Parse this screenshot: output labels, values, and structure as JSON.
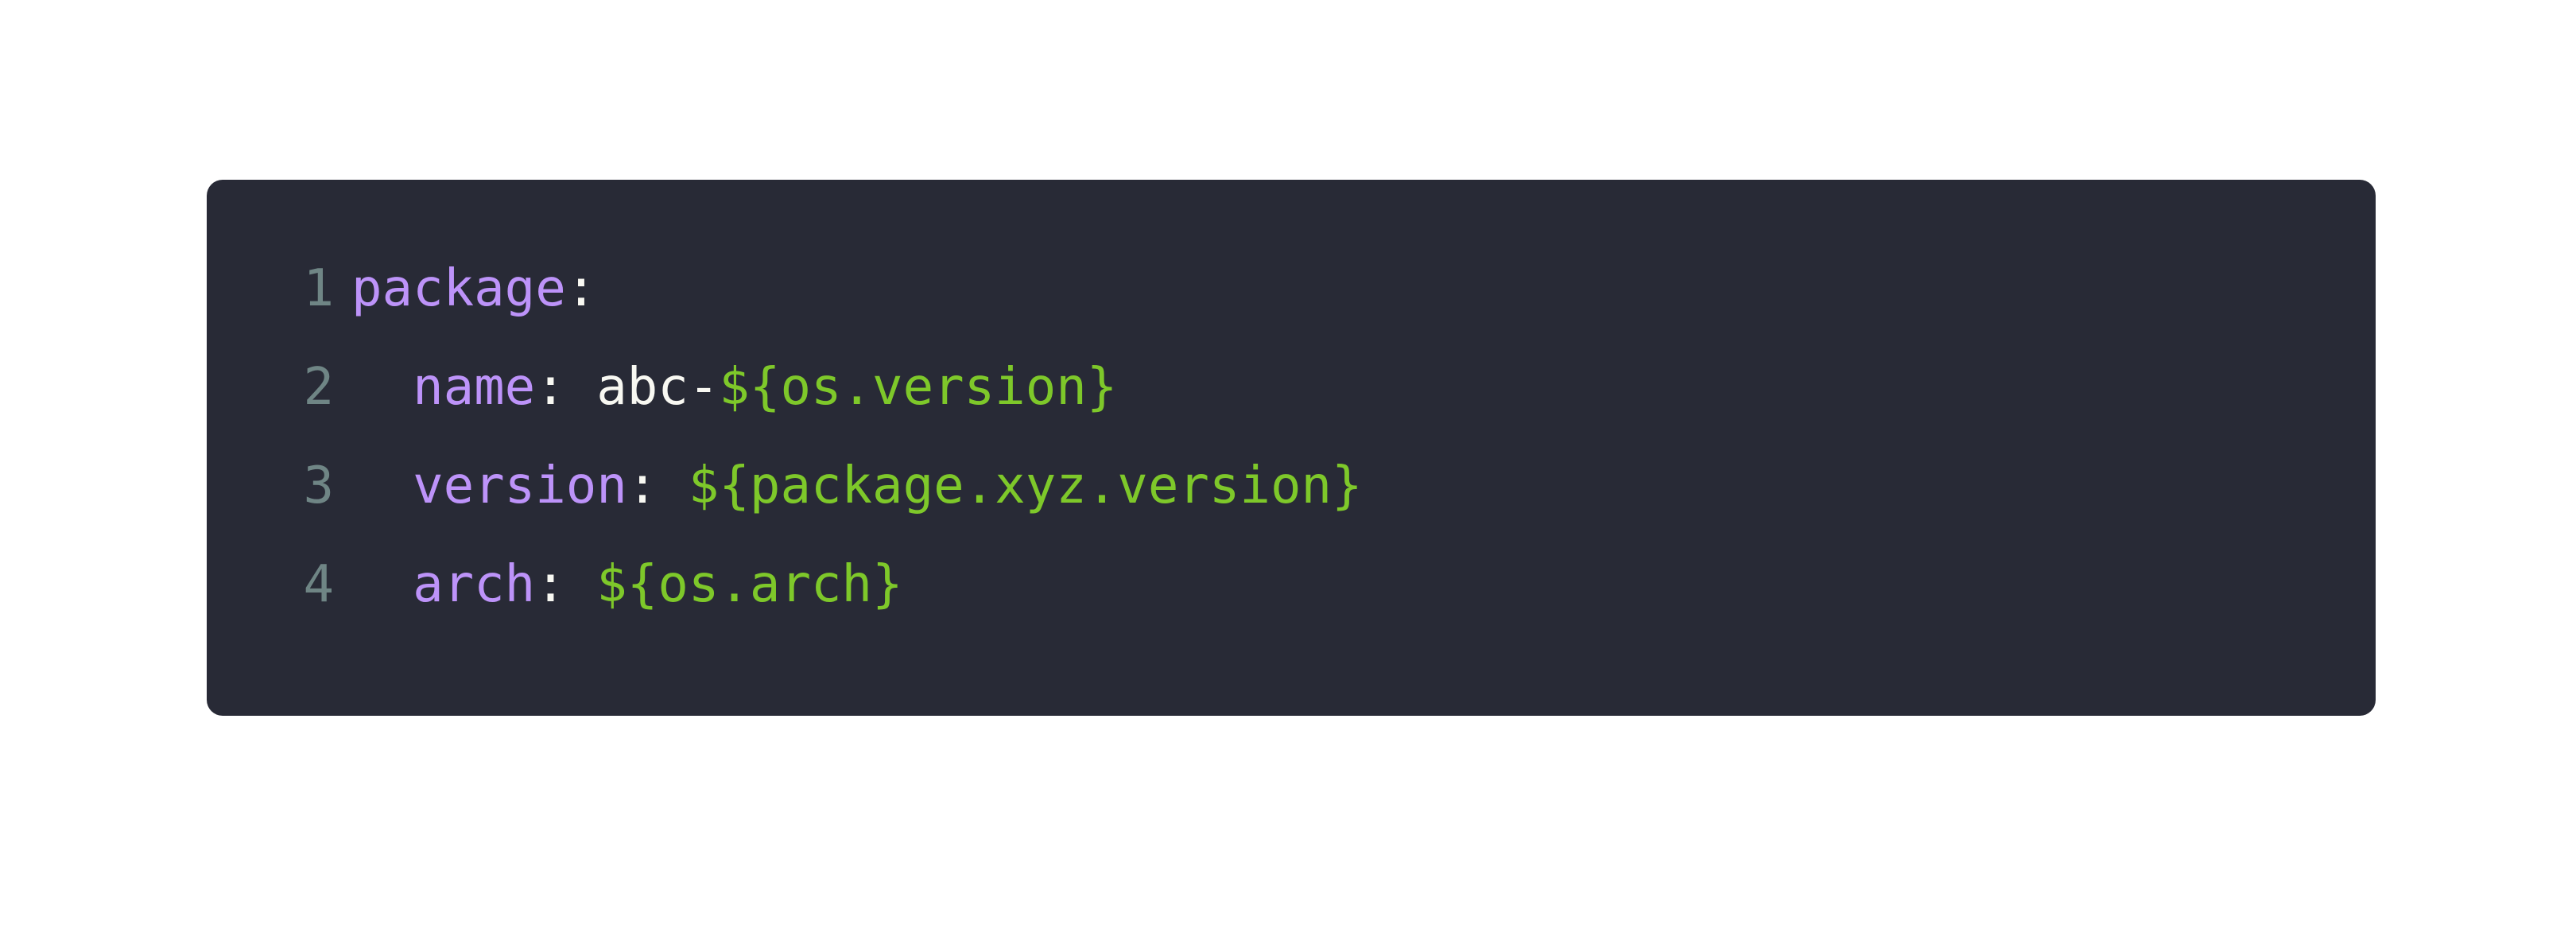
{
  "code": {
    "lines": [
      {
        "number": "1",
        "indent": "",
        "key": "package",
        "colon": ":",
        "space": "",
        "plain": "",
        "interp": ""
      },
      {
        "number": "2",
        "indent": "  ",
        "key": "name",
        "colon": ":",
        "space": " ",
        "plain": "abc-",
        "interp": "${os.version}"
      },
      {
        "number": "3",
        "indent": "  ",
        "key": "version",
        "colon": ":",
        "space": " ",
        "plain": "",
        "interp": "${package.xyz.version}"
      },
      {
        "number": "4",
        "indent": "  ",
        "key": "arch",
        "colon": ":",
        "space": " ",
        "plain": "",
        "interp": "${os.arch}"
      }
    ]
  },
  "colors": {
    "background": "#282a36",
    "key": "#bd93f9",
    "interpolation": "#7ec82a",
    "plain": "#f8f8f2",
    "line_number": "#6f8585"
  }
}
